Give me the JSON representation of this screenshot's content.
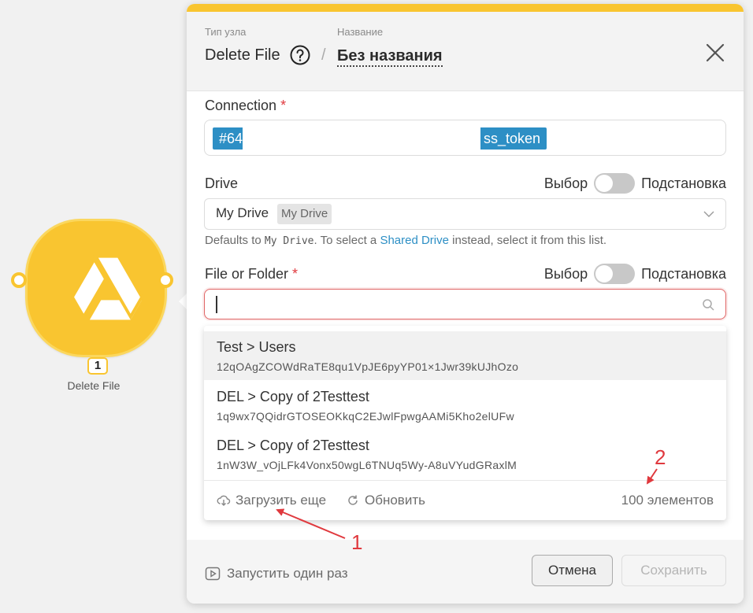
{
  "node": {
    "number": "1",
    "label": "Delete File",
    "icon": "google-drive-icon",
    "color": "#f9c530"
  },
  "header": {
    "type_caption": "Тип узла",
    "type_value": "Delete File",
    "name_caption": "Название",
    "name_value": "Без названия",
    "separator": "/"
  },
  "connection": {
    "label": "Connection",
    "required_mark": "*",
    "tag_start": "#64",
    "tag_end": "ss_token"
  },
  "drive": {
    "label": "Drive",
    "toggle_left": "Выбор",
    "toggle_right": "Подстановка",
    "value": "My Drive",
    "badge": "My Drive",
    "hint_pre": "Defaults to ",
    "hint_code": "My Drive",
    "hint_mid": ". To select a ",
    "hint_link": "Shared Drive",
    "hint_post": " instead, select it from this list."
  },
  "file": {
    "label": "File or Folder",
    "required_mark": "*",
    "toggle_left": "Выбор",
    "toggle_right": "Подстановка",
    "search_value": ""
  },
  "dropdown": {
    "items": [
      {
        "title": "Test > Users",
        "id": "12qOAgZCOWdRaTE8qu1VpJE6pyYP01×1Jwr39kUJhOzo"
      },
      {
        "title": "DEL > Copy of 2Testtest",
        "id": "1q9wx7QQidrGTOSEOKkqC2EJwlFpwgAAMi5Kho2elUFw"
      },
      {
        "title": "DEL > Copy of 2Testtest",
        "id": "1nW3W_vOjLFk4Vonx50wgL6TNUq5Wy-A8uVYudGRaxlM"
      }
    ],
    "load_more": "Загрузить еще",
    "refresh": "Обновить",
    "count": "100 элементов"
  },
  "footer": {
    "run_once": "Запустить один раз",
    "cancel": "Отмена",
    "save": "Сохранить"
  },
  "annotations": {
    "one": "1",
    "two": "2",
    "color": "#e0393e"
  }
}
